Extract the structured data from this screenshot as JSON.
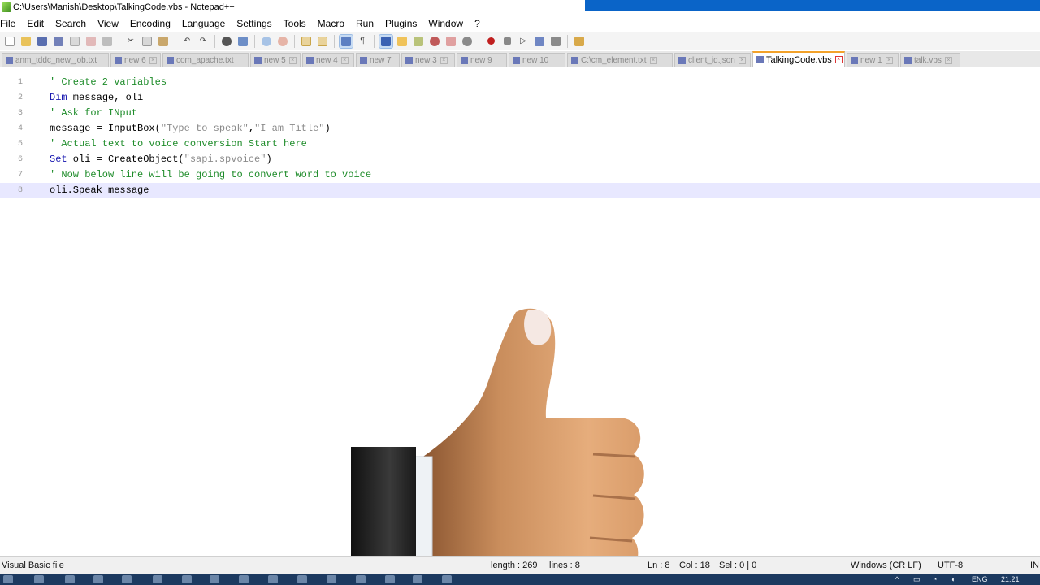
{
  "window": {
    "title": "C:\\Users\\Manish\\Desktop\\TalkingCode.vbs - Notepad++"
  },
  "menu": [
    "File",
    "Edit",
    "Search",
    "View",
    "Encoding",
    "Language",
    "Settings",
    "Tools",
    "Macro",
    "Run",
    "Plugins",
    "Window",
    "?"
  ],
  "toolbar_icons": [
    "new-file-icon",
    "open-file-icon",
    "save-icon",
    "save-all-icon",
    "close-icon",
    "close-all-icon",
    "print-icon",
    "cut-icon",
    "copy-icon",
    "paste-icon",
    "undo-icon",
    "redo-icon",
    "find-icon",
    "replace-icon",
    "zoom-in-icon",
    "zoom-out-icon",
    "sync-vertical-icon",
    "sync-horizontal-icon",
    "word-wrap-icon",
    "show-all-chars-icon",
    "indent-guide-icon",
    "doc-map-icon",
    "function-list-icon",
    "folder-workspace-icon",
    "monitoring-icon",
    "record-macro-icon",
    "stop-record-icon",
    "playback-icon",
    "run-macro-multiple-icon",
    "save-macro-icon",
    "plugin-icon"
  ],
  "tabs": [
    {
      "label": "anm_tddc_new_job.txt",
      "active": false
    },
    {
      "label": "new 6",
      "active": false
    },
    {
      "label": "com_apache.txt",
      "active": false
    },
    {
      "label": "new 5",
      "active": false
    },
    {
      "label": "new 4",
      "active": false
    },
    {
      "label": "new 7",
      "active": false
    },
    {
      "label": "new 3",
      "active": false
    },
    {
      "label": "new 9",
      "active": false
    },
    {
      "label": "new 10",
      "active": false
    },
    {
      "label": "C:\\cm_element.txt",
      "active": false
    },
    {
      "label": "client_id.json",
      "active": false
    },
    {
      "label": "TalkingCode.vbs",
      "active": true
    },
    {
      "label": "new 1",
      "active": false
    },
    {
      "label": "talk.vbs",
      "active": false
    }
  ],
  "editor": {
    "lines": [
      {
        "num": "1",
        "tokens": [
          {
            "t": "' Create 2 variables",
            "c": "comment"
          }
        ]
      },
      {
        "num": "2",
        "tokens": [
          {
            "t": "Dim",
            "c": "keyword"
          },
          {
            "t": " message, oli",
            "c": "plain"
          }
        ]
      },
      {
        "num": "3",
        "tokens": [
          {
            "t": "' Ask for INput",
            "c": "comment"
          }
        ]
      },
      {
        "num": "4",
        "tokens": [
          {
            "t": "message = InputBox(",
            "c": "plain"
          },
          {
            "t": "\"Type to speak\"",
            "c": "string"
          },
          {
            "t": ",",
            "c": "plain"
          },
          {
            "t": "\"I am Title\"",
            "c": "string"
          },
          {
            "t": ")",
            "c": "plain"
          }
        ]
      },
      {
        "num": "5",
        "tokens": [
          {
            "t": "' Actual text to voice conversion Start here",
            "c": "comment"
          }
        ]
      },
      {
        "num": "6",
        "tokens": [
          {
            "t": "Set",
            "c": "keyword"
          },
          {
            "t": " oli = CreateObject(",
            "c": "plain"
          },
          {
            "t": "\"sapi.spvoice\"",
            "c": "string"
          },
          {
            "t": ")",
            "c": "plain"
          }
        ]
      },
      {
        "num": "7",
        "tokens": [
          {
            "t": "' Now below line will be going to convert word to voice",
            "c": "comment"
          }
        ]
      },
      {
        "num": "8",
        "tokens": [
          {
            "t": "oli.Speak message",
            "c": "plain"
          }
        ]
      }
    ],
    "current_line": "8"
  },
  "overlay": {
    "icon": "thumbs-up-icon"
  },
  "status": {
    "language": "Visual Basic file",
    "length": "length : 269",
    "lines": "lines : 8",
    "ln": "Ln : 8",
    "col": "Col : 18",
    "sel": "Sel : 0 | 0",
    "eol": "Windows (CR LF)",
    "encoding": "UTF-8",
    "ins": "IN"
  },
  "taskbar": {
    "lang": "ENG",
    "time": "21:21"
  },
  "colors": {
    "comment": "#1e8c2a",
    "keyword": "#1818b0",
    "string": "#8a8a8a",
    "current_line": "#e8e8ff",
    "active_tab_accent": "#f3a22a"
  }
}
